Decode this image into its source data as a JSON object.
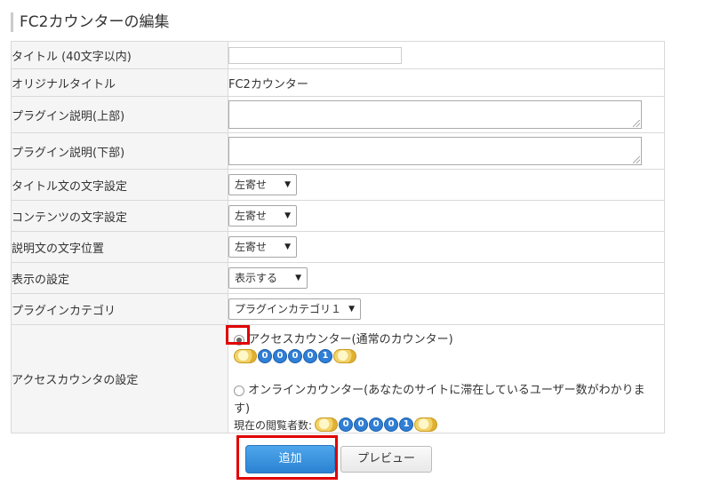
{
  "page": {
    "title": "FC2カウンターの編集"
  },
  "form": {
    "title_label": "タイトル (40文字以内)",
    "title_value": "",
    "original_title_label": "オリジナルタイトル",
    "original_title_value": "FC2カウンター",
    "desc_top_label": "プラグイン説明(上部)",
    "desc_bottom_label": "プラグイン説明(下部)",
    "title_align_label": "タイトル文の文字設定",
    "title_align_value": "左寄せ",
    "content_align_label": "コンテンツの文字設定",
    "content_align_value": "左寄せ",
    "desc_align_label": "説明文の文字位置",
    "desc_align_value": "左寄せ",
    "display_label": "表示の設定",
    "display_value": "表示する",
    "category_label": "プラグインカテゴリ",
    "category_value": "プラグインカテゴリ１",
    "counter_label": "アクセスカウンタの設定",
    "counter_option_access": "アクセスカウンター(通常のカウンター)",
    "counter_option_online_line1": "オンラインカウンター(あなたのサイトに滞在しているユーザー数がわかりま",
    "counter_option_online_line2": "す)",
    "current_viewers_label": "現在の閲覧者数:",
    "counter_digits": [
      "0",
      "0",
      "0",
      "0",
      "1"
    ],
    "selected_option": "access"
  },
  "buttons": {
    "add": "追加",
    "preview": "プレビュー"
  },
  "colors": {
    "add_button": "#2b82d1",
    "highlight": "#e00000",
    "label_bg": "#f5f5f5",
    "border": "#d9d9d9"
  }
}
